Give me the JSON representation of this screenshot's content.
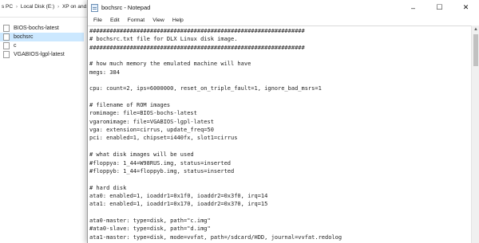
{
  "explorer": {
    "breadcrumb": [
      "s PC",
      "Local Disk (E:)",
      "XP on and..."
    ],
    "files": [
      {
        "name": "BIOS-bochs-latest",
        "type": "file",
        "selected": false
      },
      {
        "name": "bochsrc",
        "type": "file",
        "selected": true
      },
      {
        "name": "c",
        "type": "folder",
        "selected": false
      },
      {
        "name": "VGABIOS-lgpl-latest",
        "type": "file",
        "selected": false
      }
    ]
  },
  "notepad": {
    "title": "bochsrc - Notepad",
    "controls": {
      "minimize": "–",
      "maximize": "☐",
      "close": "✕"
    },
    "menu": [
      "File",
      "Edit",
      "Format",
      "View",
      "Help"
    ],
    "lines": [
      "################################################################",
      "# bochsrc.txt file for DLX Linux disk image.",
      "################################################################",
      "",
      "# how much memory the emulated machine will have",
      "megs: 384",
      "",
      "cpu: count=2, ips=6000000, reset_on_triple_fault=1, ignore_bad_msrs=1",
      "",
      "# filename of ROM images",
      "romimage: file=BIOS-bochs-latest",
      "vgaromimage: file=VGABIOS-lgpl-latest",
      "vga: extension=cirrus, update_freq=50",
      "pci: enabled=1, chipset=i440fx, slot1=cirrus",
      "",
      "# what disk images will be used",
      "#floppya: 1_44=W98RUS.img, status=inserted",
      "#floppyb: 1_44=floppyb.img, status=inserted",
      "",
      "# hard disk",
      "ata0: enabled=1, ioaddr1=0x1f0, ioaddr2=0x3f0, irq=14",
      "ata1: enabled=1, ioaddr1=0x170, ioaddr2=0x370, irq=15",
      "",
      "ata0-master: type=disk, path=\"c.img\"",
      "#ata0-slave: type=disk, path=\"d.img\"",
      "ata1-master: type=disk, mode=vvfat, path=/sdcard/HDD, journal=vvfat.redolog"
    ]
  }
}
